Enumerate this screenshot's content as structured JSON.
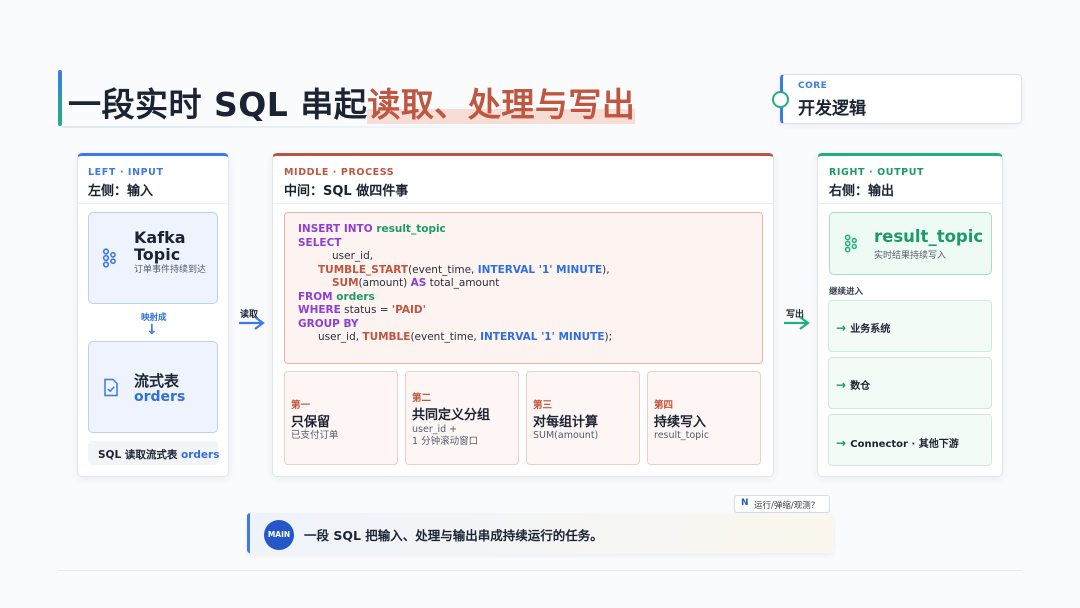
{
  "title": {
    "prefix": "一段实时 SQL 串起",
    "highlight": "读取、处理与写出"
  },
  "core": {
    "tag": "CORE",
    "title": "开发逻辑"
  },
  "left": {
    "tag": "LEFT · INPUT",
    "title": "左侧：输入",
    "kafka": {
      "name_line1": "Kafka",
      "name_line2": "Topic",
      "desc": "订单事件持续到达"
    },
    "map_label": "映射成",
    "stream": {
      "name": "流式表",
      "table": "orders"
    },
    "footer": {
      "text": "SQL 读取流式表 ",
      "table": "orders"
    }
  },
  "flow": {
    "read": "读取",
    "write": "写出"
  },
  "middle": {
    "tag": "MIDDLE · PROCESS",
    "title": "中间：SQL 做四件事",
    "code": {
      "l1_kw": "INSERT INTO ",
      "l1_tbl": "result_topic",
      "l2_kw": "SELECT",
      "l3": "user_id,",
      "l4_fn": "TUMBLE_START",
      "l4_a": "(event_time, ",
      "l4_kw": "INTERVAL '1' MINUTE",
      "l4_b": "),",
      "l5_fn": "SUM",
      "l5_a": "(amount) ",
      "l5_kw": "AS",
      "l5_b": " total_amount",
      "l6_kw": "FROM ",
      "l6_tbl": "orders",
      "l7_kw": "WHERE",
      "l7_a": " status = ",
      "l7_str": "'PAID'",
      "l8_kw": "GROUP BY",
      "l9_a": "user_id, ",
      "l9_fn": "TUMBLE",
      "l9_b": "(event_time, ",
      "l9_kw": "INTERVAL '1' MINUTE",
      "l9_c": ");"
    },
    "steps": [
      {
        "tag": "第一",
        "title": "只保留",
        "desc_1": "已支付订单",
        "desc_2": ""
      },
      {
        "tag": "第二",
        "title": "共同定义分组",
        "desc_1": "user_id +",
        "desc_2": "1 分钟滚动窗口"
      },
      {
        "tag": "第三",
        "title": "对每组计算",
        "desc_1": "SUM(amount)",
        "desc_2": ""
      },
      {
        "tag": "第四",
        "title": "持续写入",
        "desc_1": "result_topic",
        "desc_2": ""
      }
    ]
  },
  "right": {
    "tag": "RIGHT · OUTPUT",
    "title": "右侧：输出",
    "result": {
      "name": "result_topic",
      "desc": "实时结果持续写入"
    },
    "continue_label": "继续进入",
    "targets": [
      "业务系统",
      "数仓",
      "Connector · 其他下游"
    ]
  },
  "main": {
    "badge": "MAIN",
    "text": "一段 SQL 把输入、处理与输出串成持续运行的任务。"
  },
  "note": {
    "badge": "N",
    "text": "运行/弹缩/观测?"
  },
  "colors": {
    "blue": "#3b7be8",
    "rust": "#c0563f",
    "green": "#22b07a",
    "purple": "#8c3fd1"
  }
}
